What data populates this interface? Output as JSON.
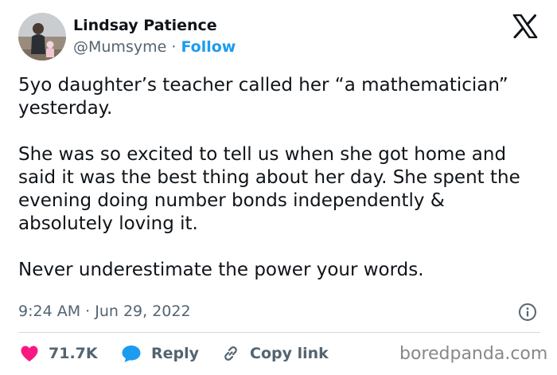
{
  "user": {
    "display_name": "Lindsay Patience",
    "handle": "@Mumsyme",
    "separator": "·",
    "follow_label": "Follow"
  },
  "tweet": {
    "paragraphs": [
      "5yo daughter’s teacher called her “a mathematician” yesterday.",
      "She was so excited to tell us when she got home and said it was the best thing about her day. She spent the evening doing number bonds independently & absolutely loving it.",
      "Never underestimate the power your words."
    ],
    "timestamp": "9:24 AM · Jun 29, 2022"
  },
  "actions": {
    "like_count": "71.7K",
    "reply_label": "Reply",
    "copy_link_label": "Copy link"
  },
  "watermark": "boredpanda.com",
  "colors": {
    "text": "#0f1419",
    "secondary": "#536471",
    "follow": "#1d9bf0",
    "like": "#f91880",
    "reply": "#1d9bf0",
    "divider": "#cfd9de"
  },
  "icons": {
    "platform": "x-logo-icon",
    "info": "info-icon",
    "like": "heart-icon",
    "reply": "speech-bubble-icon",
    "copy_link": "link-icon"
  }
}
